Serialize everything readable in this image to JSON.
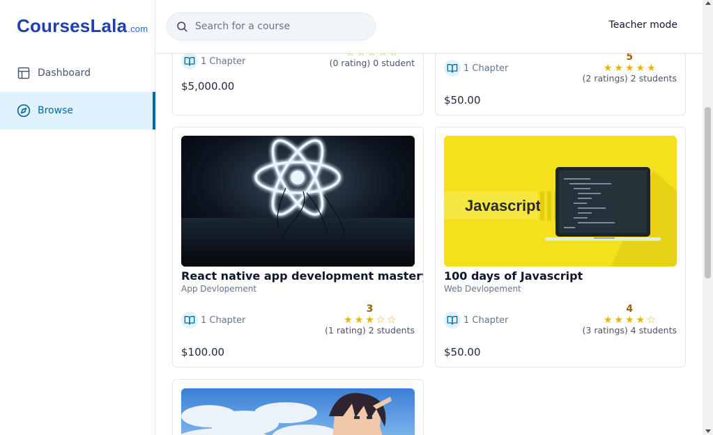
{
  "app": {
    "logo_main": "CoursesLala",
    "logo_suffix": ".com"
  },
  "sidebar": {
    "items": [
      {
        "label": "Dashboard",
        "icon": "layout-icon",
        "active": false
      },
      {
        "label": "Browse",
        "icon": "compass-icon",
        "active": true
      }
    ]
  },
  "header": {
    "search_placeholder": "Search for a course",
    "search_value": "",
    "teacher_mode_label": "Teacher mode"
  },
  "colors": {
    "brand": "#1e40af",
    "active_bg": "#e0f2fe",
    "active_accent": "#0369a1",
    "star": "#eab308",
    "rating_number": "#a16207"
  },
  "cards": [
    {
      "title": "",
      "category": "",
      "chapters": "1 Chapter",
      "rating_value": "",
      "stars_filled": 0,
      "ratings_label": "(0 rating)",
      "students_label": "0 student",
      "price": "$5,000.00"
    },
    {
      "title": "",
      "category": "",
      "chapters": "1 Chapter",
      "rating_value": "5",
      "stars_filled": 5,
      "ratings_label": "(2 ratings)",
      "students_label": "2 students",
      "price": "$50.00"
    },
    {
      "title": "React native app development mastery",
      "category": "App Devlopement",
      "chapters": "1 Chapter",
      "rating_value": "3",
      "stars_filled": 3,
      "ratings_label": "(1 rating)",
      "students_label": "2 students",
      "price": "$100.00"
    },
    {
      "title": "100 days of Javascript",
      "category": "Web Devlopement",
      "chapters": "1 Chapter",
      "rating_value": "4",
      "stars_filled": 4,
      "ratings_label": "(3 ratings)",
      "students_label": "4 students",
      "price": "$50.00",
      "thumbnail_text": "Javascript"
    },
    {
      "title": "",
      "category": "",
      "thumbnail": "anime-character-sky"
    }
  ]
}
